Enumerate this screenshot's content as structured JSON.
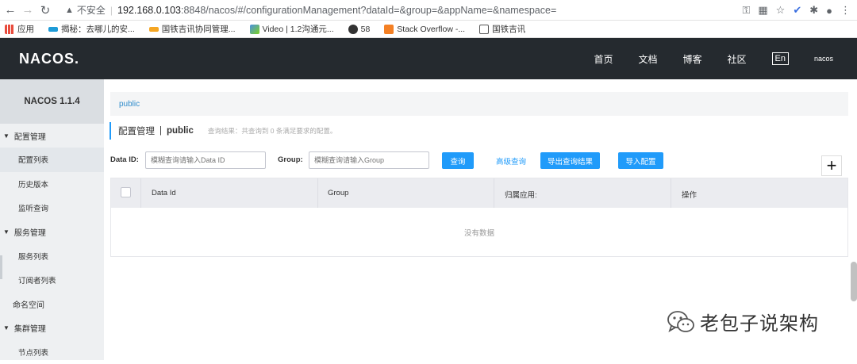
{
  "browser": {
    "insecure_label": "不安全",
    "url_host": "192.168.0.103",
    "url_rest": ":8848/nacos/#/configurationManagement?dataId=&group=&appName=&namespace=",
    "bookmarks": [
      {
        "label": "应用",
        "icon": "apps-grid-icon"
      },
      {
        "label": "揭秘：去哪儿的安...",
        "icon": "qunar-icon"
      },
      {
        "label": "国铁吉讯协同管理...",
        "icon": "ad-icon"
      },
      {
        "label": "Video | 1.2沟通元...",
        "icon": "video-icon"
      },
      {
        "label": "58",
        "icon": "globe-icon"
      },
      {
        "label": "Stack Overflow -...",
        "icon": "stackoverflow-icon"
      },
      {
        "label": "国铁吉讯",
        "icon": "folder-icon"
      }
    ]
  },
  "header": {
    "logo": "NACOS.",
    "nav": [
      "首页",
      "文档",
      "博客",
      "社区"
    ],
    "lang": "En",
    "user": "nacos"
  },
  "sidebar": {
    "version": "NACOS 1.1.4",
    "groups": [
      {
        "label": "配置管理",
        "items": [
          "配置列表",
          "历史版本",
          "监听查询"
        ]
      },
      {
        "label": "服务管理",
        "items": [
          "服务列表",
          "订阅者列表"
        ]
      }
    ],
    "namespace": "命名空间",
    "cluster": {
      "label": "集群管理",
      "items": [
        "节点列表"
      ]
    }
  },
  "main": {
    "breadcrumb": "public",
    "title": "配置管理",
    "title_sep": "|",
    "title_ns": "public",
    "hint": "查询结果：共查询到 0 条满足要求的配置。",
    "dataid_label": "Data ID:",
    "dataid_placeholder": "模糊查询请输入Data ID",
    "group_label": "Group:",
    "group_placeholder": "模糊查询请输入Group",
    "query_button": "查询",
    "advanced_link": "高级查询",
    "export_button": "导出查询结果",
    "import_button": "导入配置",
    "add_button": "+",
    "columns": [
      "Data Id",
      "Group",
      "归属应用:",
      "操作"
    ],
    "empty_text": "没有数据"
  },
  "watermark": {
    "text": "老包子说架构"
  },
  "colors": {
    "accent": "#209bfa",
    "header_bg": "#252a2f",
    "sidebar_bg": "#eef0f2"
  }
}
